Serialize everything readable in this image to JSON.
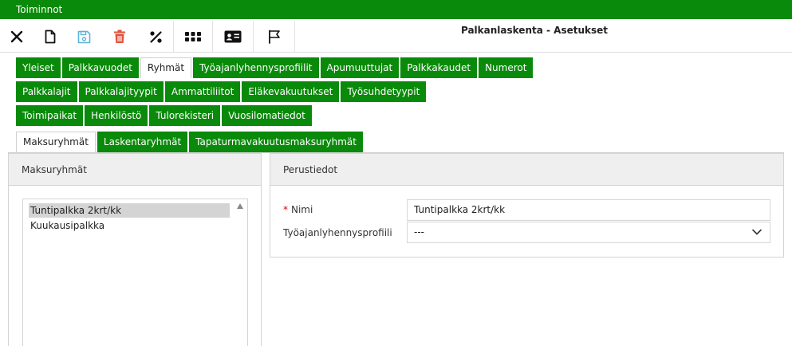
{
  "topbar": {
    "title": "Toiminnot"
  },
  "toolbar": {
    "buttons": [
      {
        "icon": "close-icon"
      },
      {
        "icon": "new-document-icon"
      },
      {
        "icon": "save-icon"
      },
      {
        "icon": "trash-icon"
      },
      {
        "icon": "percent-icon"
      },
      {
        "icon": "grid-dots-icon"
      },
      {
        "icon": "id-card-icon"
      },
      {
        "icon": "flag-icon"
      }
    ],
    "page_title": "Palkanlaskenta - Asetukset"
  },
  "colors": {
    "accent_green": "#0a8a0a",
    "delete_red": "#e0533f",
    "save_blue": "#5ab4d6",
    "required_red": "#dd0000"
  },
  "tabs": {
    "row1": [
      "Yleiset",
      "Palkkavuodet",
      "Ryhmät",
      "Työajanlyhennysprofiilit",
      "Apumuuttujat",
      "Palkkakaudet",
      "Numerot"
    ],
    "row2": [
      "Palkkalajit",
      "Palkkalajityypit",
      "Ammattiliitot",
      "Eläkevakuutukset",
      "Työsuhdetyypit"
    ],
    "row3": [
      "Toimipaikat",
      "Henkilöstö",
      "Tulorekisteri",
      "Vuosilomatiedot"
    ],
    "active": "Ryhmät"
  },
  "subtabs": {
    "items": [
      "Maksuryhmät",
      "Laskentaryhmät",
      "Tapaturmavakuutusmaksuryhmät"
    ],
    "active": "Maksuryhmät"
  },
  "left_panel": {
    "title": "Maksuryhmät",
    "items": [
      "Tuntipalkka 2krt/kk",
      "Kuukausipalkka"
    ],
    "selected": "Tuntipalkka 2krt/kk"
  },
  "right_panel": {
    "title": "Perustiedot",
    "name_label": "Nimi",
    "name_required_marker": "*",
    "name_value": "Tuntipalkka 2krt/kk",
    "profile_label": "Työajanlyhennysprofiili",
    "profile_value": "---"
  }
}
